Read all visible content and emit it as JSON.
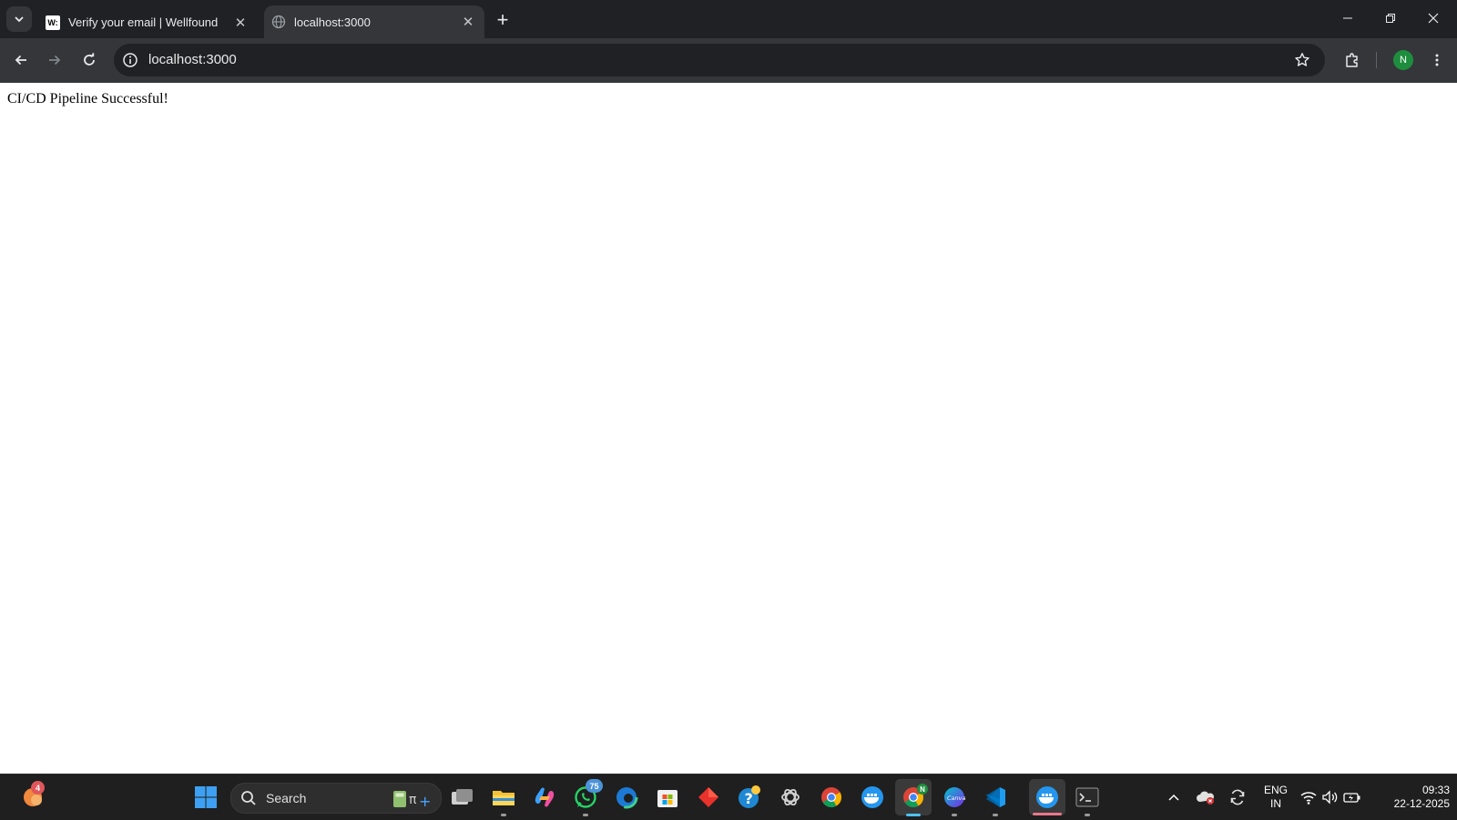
{
  "browser": {
    "tabs": [
      {
        "title": "Verify your email | Wellfound",
        "favicon": "wellfound-logo",
        "active": false
      },
      {
        "title": "localhost:3000",
        "favicon": "globe-icon",
        "active": true
      }
    ],
    "favicon_text": "W:",
    "address": "localhost:3000",
    "profile_initial": "N"
  },
  "page": {
    "text": "CI/CD Pipeline Successful!"
  },
  "taskbar": {
    "search_label": "Search",
    "whatsapp_badge": "75",
    "notification_badge": "4",
    "chrome_profile_badge": "N",
    "apps": [
      "notifications",
      "start",
      "search",
      "calculator",
      "task-view",
      "file-explorer",
      "copilot",
      "whatsapp",
      "edge",
      "microsoft-store",
      "git-client",
      "help",
      "chatgpt",
      "chrome",
      "docker",
      "chrome-profile",
      "canva",
      "vscode",
      "docker-desktop",
      "terminal"
    ],
    "language": "ENG",
    "region": "IN",
    "time": "09:33",
    "date": "22-12-2025"
  },
  "colors": {
    "tabstrip": "#202124",
    "toolbar": "#35363a",
    "taskbar": "#1f1f1f",
    "accent": "#4cc2ff"
  }
}
